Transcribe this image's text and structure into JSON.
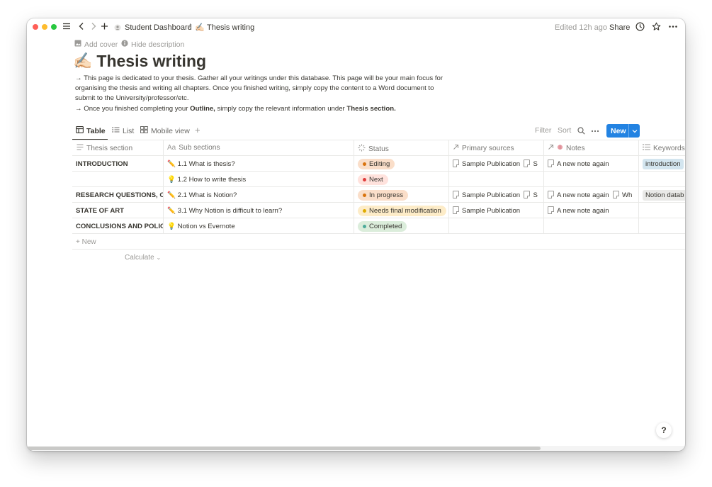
{
  "breadcrumb": {
    "parent_label": "Student Dashboard",
    "separator": "/",
    "page_emoji": "✍🏻",
    "current_label": "Thesis writing"
  },
  "topbar": {
    "edited_text": "Edited 12h ago",
    "share_label": "Share"
  },
  "header": {
    "add_cover_label": "Add cover",
    "hide_description_label": "Hide description",
    "title_emoji": "✍🏻",
    "title": "Thesis writing",
    "description_line1": "→ This page is dedicated to your thesis. Gather all your writings under this database. This page will be your main focus for organising the thesis and writing all chapters. Once you finished writing, simply copy the content to a Word document to submit to the University/professor/etc.",
    "description_line2_pre": "→ Once you finished completing your ",
    "description_line2_bold1": "Outline,",
    "description_line2_mid": " simply copy the relevant information under ",
    "description_line2_bold2": "Thesis section."
  },
  "views": {
    "tabs": [
      {
        "label": "Table",
        "active": true
      },
      {
        "label": "List",
        "active": false
      },
      {
        "label": "Mobile view",
        "active": false
      }
    ],
    "filter_label": "Filter",
    "sort_label": "Sort",
    "new_label": "New"
  },
  "table": {
    "columns": [
      {
        "label": "Thesis section",
        "icon": "text-lines-icon"
      },
      {
        "label": "Sub sections",
        "icon": "title-aa-icon"
      },
      {
        "label": "Status",
        "icon": "status-loading-icon"
      },
      {
        "label": "Primary sources",
        "icon": "relation-arrow-icon"
      },
      {
        "label": "Notes",
        "icon": "relation-arrow-icon"
      },
      {
        "label": "Keywords",
        "icon": "multi-select-icon"
      }
    ],
    "rows": [
      {
        "section": "INTRODUCTION",
        "sub_emoji": "✏️",
        "sub": "1.1 What is thesis?",
        "status": "Editing",
        "status_bg": "#fadec9",
        "status_dot": "#d9730d",
        "source": "Sample Publication",
        "source_extra": "S",
        "note": "A new note again",
        "note_extra": "",
        "keyword": "introduction",
        "keyword_bg": "#d3e5ef"
      },
      {
        "section": "",
        "sub_emoji": "💡",
        "sub": "1.2 How to write thesis",
        "status": "Next",
        "status_bg": "#ffe2dd",
        "status_dot": "#e03e3e",
        "source": "",
        "source_extra": "",
        "note": "",
        "note_extra": "",
        "keyword": "",
        "keyword_bg": ""
      },
      {
        "section": "RESEARCH QUESTIONS, OI",
        "sub_emoji": "✏️",
        "sub": "2.1 What is Notion?",
        "status": "In progress",
        "status_bg": "#fadec9",
        "status_dot": "#d9730d",
        "source": "Sample Publication",
        "source_extra": "S",
        "note": "A new note again",
        "note_extra": "Wh",
        "keyword": "Notion datab",
        "keyword_bg": "#e9e9e7"
      },
      {
        "section": "STATE OF ART",
        "sub_emoji": "✏️",
        "sub": "3.1 Why Notion is difficult to learn?",
        "status": "Needs final modification",
        "status_bg": "#fdecc8",
        "status_dot": "#dfab01",
        "source": "Sample Publication",
        "source_extra": "",
        "note": "A new note again",
        "note_extra": "",
        "keyword": "",
        "keyword_bg": ""
      },
      {
        "section": "CONCLUSIONS AND POLIC",
        "sub_emoji": "💡",
        "sub": "Notion vs Evernote",
        "status": "Completed",
        "status_bg": "#dbeddb",
        "status_dot": "#4dab9a",
        "source": "",
        "source_extra": "",
        "note": "",
        "note_extra": "",
        "keyword": "",
        "keyword_bg": ""
      }
    ],
    "new_row_label": "New",
    "calculate_label": "Calculate"
  },
  "help_label": "?"
}
